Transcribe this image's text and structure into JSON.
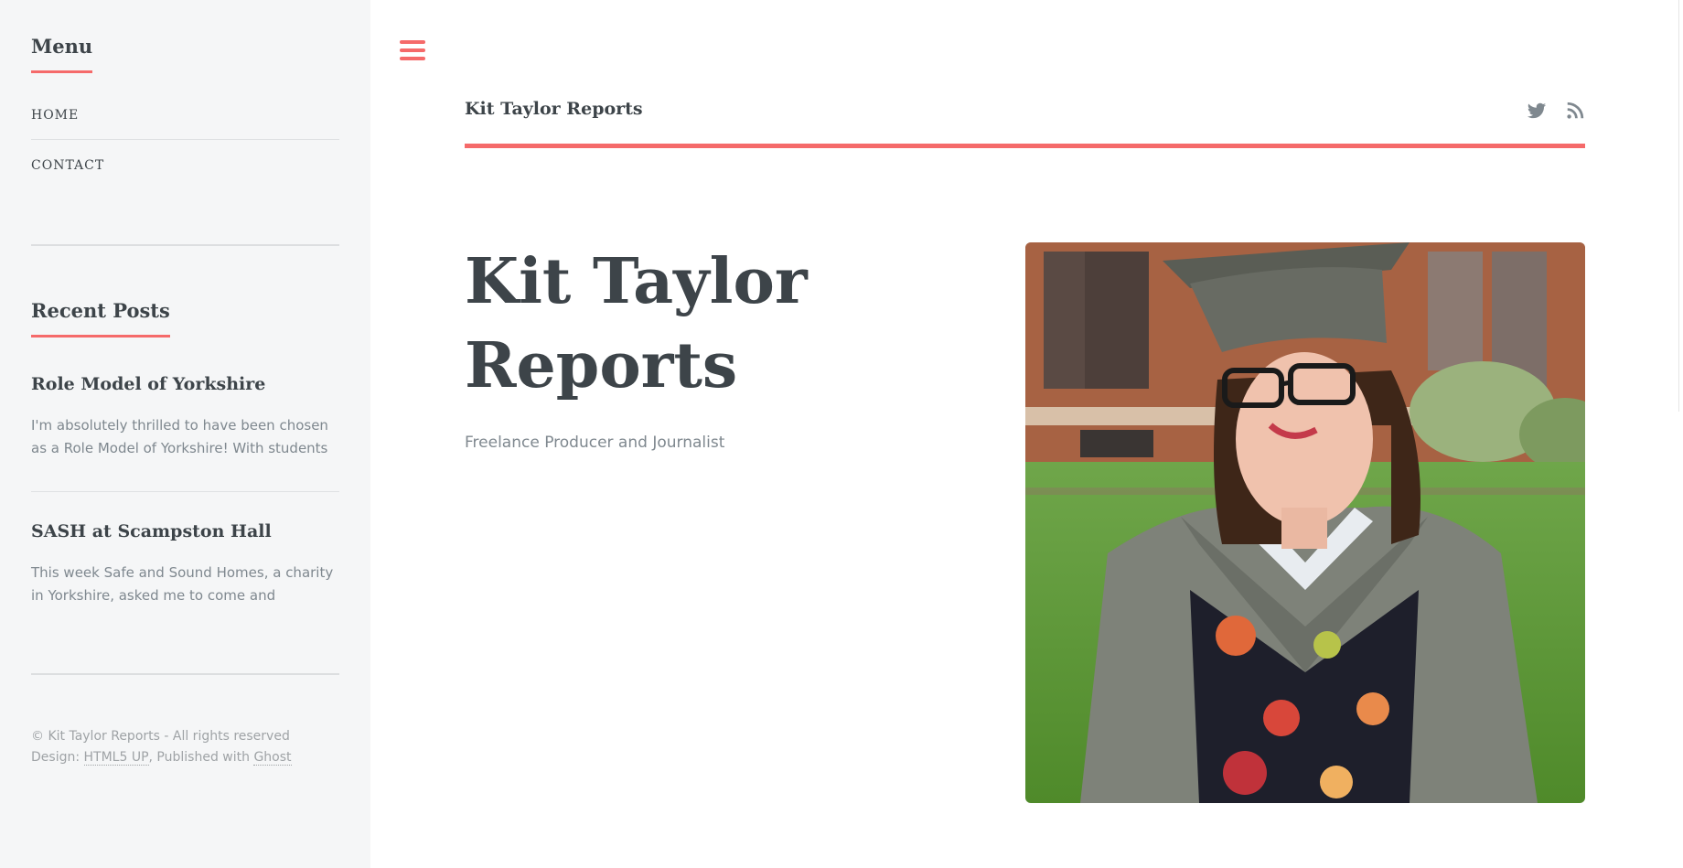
{
  "sidebar": {
    "menu_heading": "Menu",
    "menu_items": [
      {
        "label": "HOME"
      },
      {
        "label": "CONTACT"
      }
    ],
    "recent_heading": "Recent Posts",
    "posts": [
      {
        "title": "Role Model of Yorkshire",
        "excerpt": "I'm absolutely thrilled to have been chosen as a Role Model of Yorkshire! With students"
      },
      {
        "title": "SASH at Scampston Hall",
        "excerpt": "This week Safe and Sound Homes, a charity in Yorkshire, asked me to come and"
      }
    ],
    "footer": {
      "copyright": "© Kit Taylor Reports - All rights reserved",
      "design_prefix": "Design: ",
      "design_link": "HTML5 UP",
      "published_text": ", Published with ",
      "ghost_link": "Ghost"
    }
  },
  "header": {
    "logo": "Kit Taylor Reports",
    "icons": [
      "twitter-icon",
      "rss-icon"
    ]
  },
  "banner": {
    "title": "Kit Taylor Reports",
    "subtitle": "Freelance Producer and Journalist",
    "image_alt": "graduation-portrait"
  },
  "colors": {
    "accent": "#f56a6a",
    "text": "#3d4449",
    "muted": "#7f888f",
    "sidebar_bg": "#f5f6f7"
  }
}
